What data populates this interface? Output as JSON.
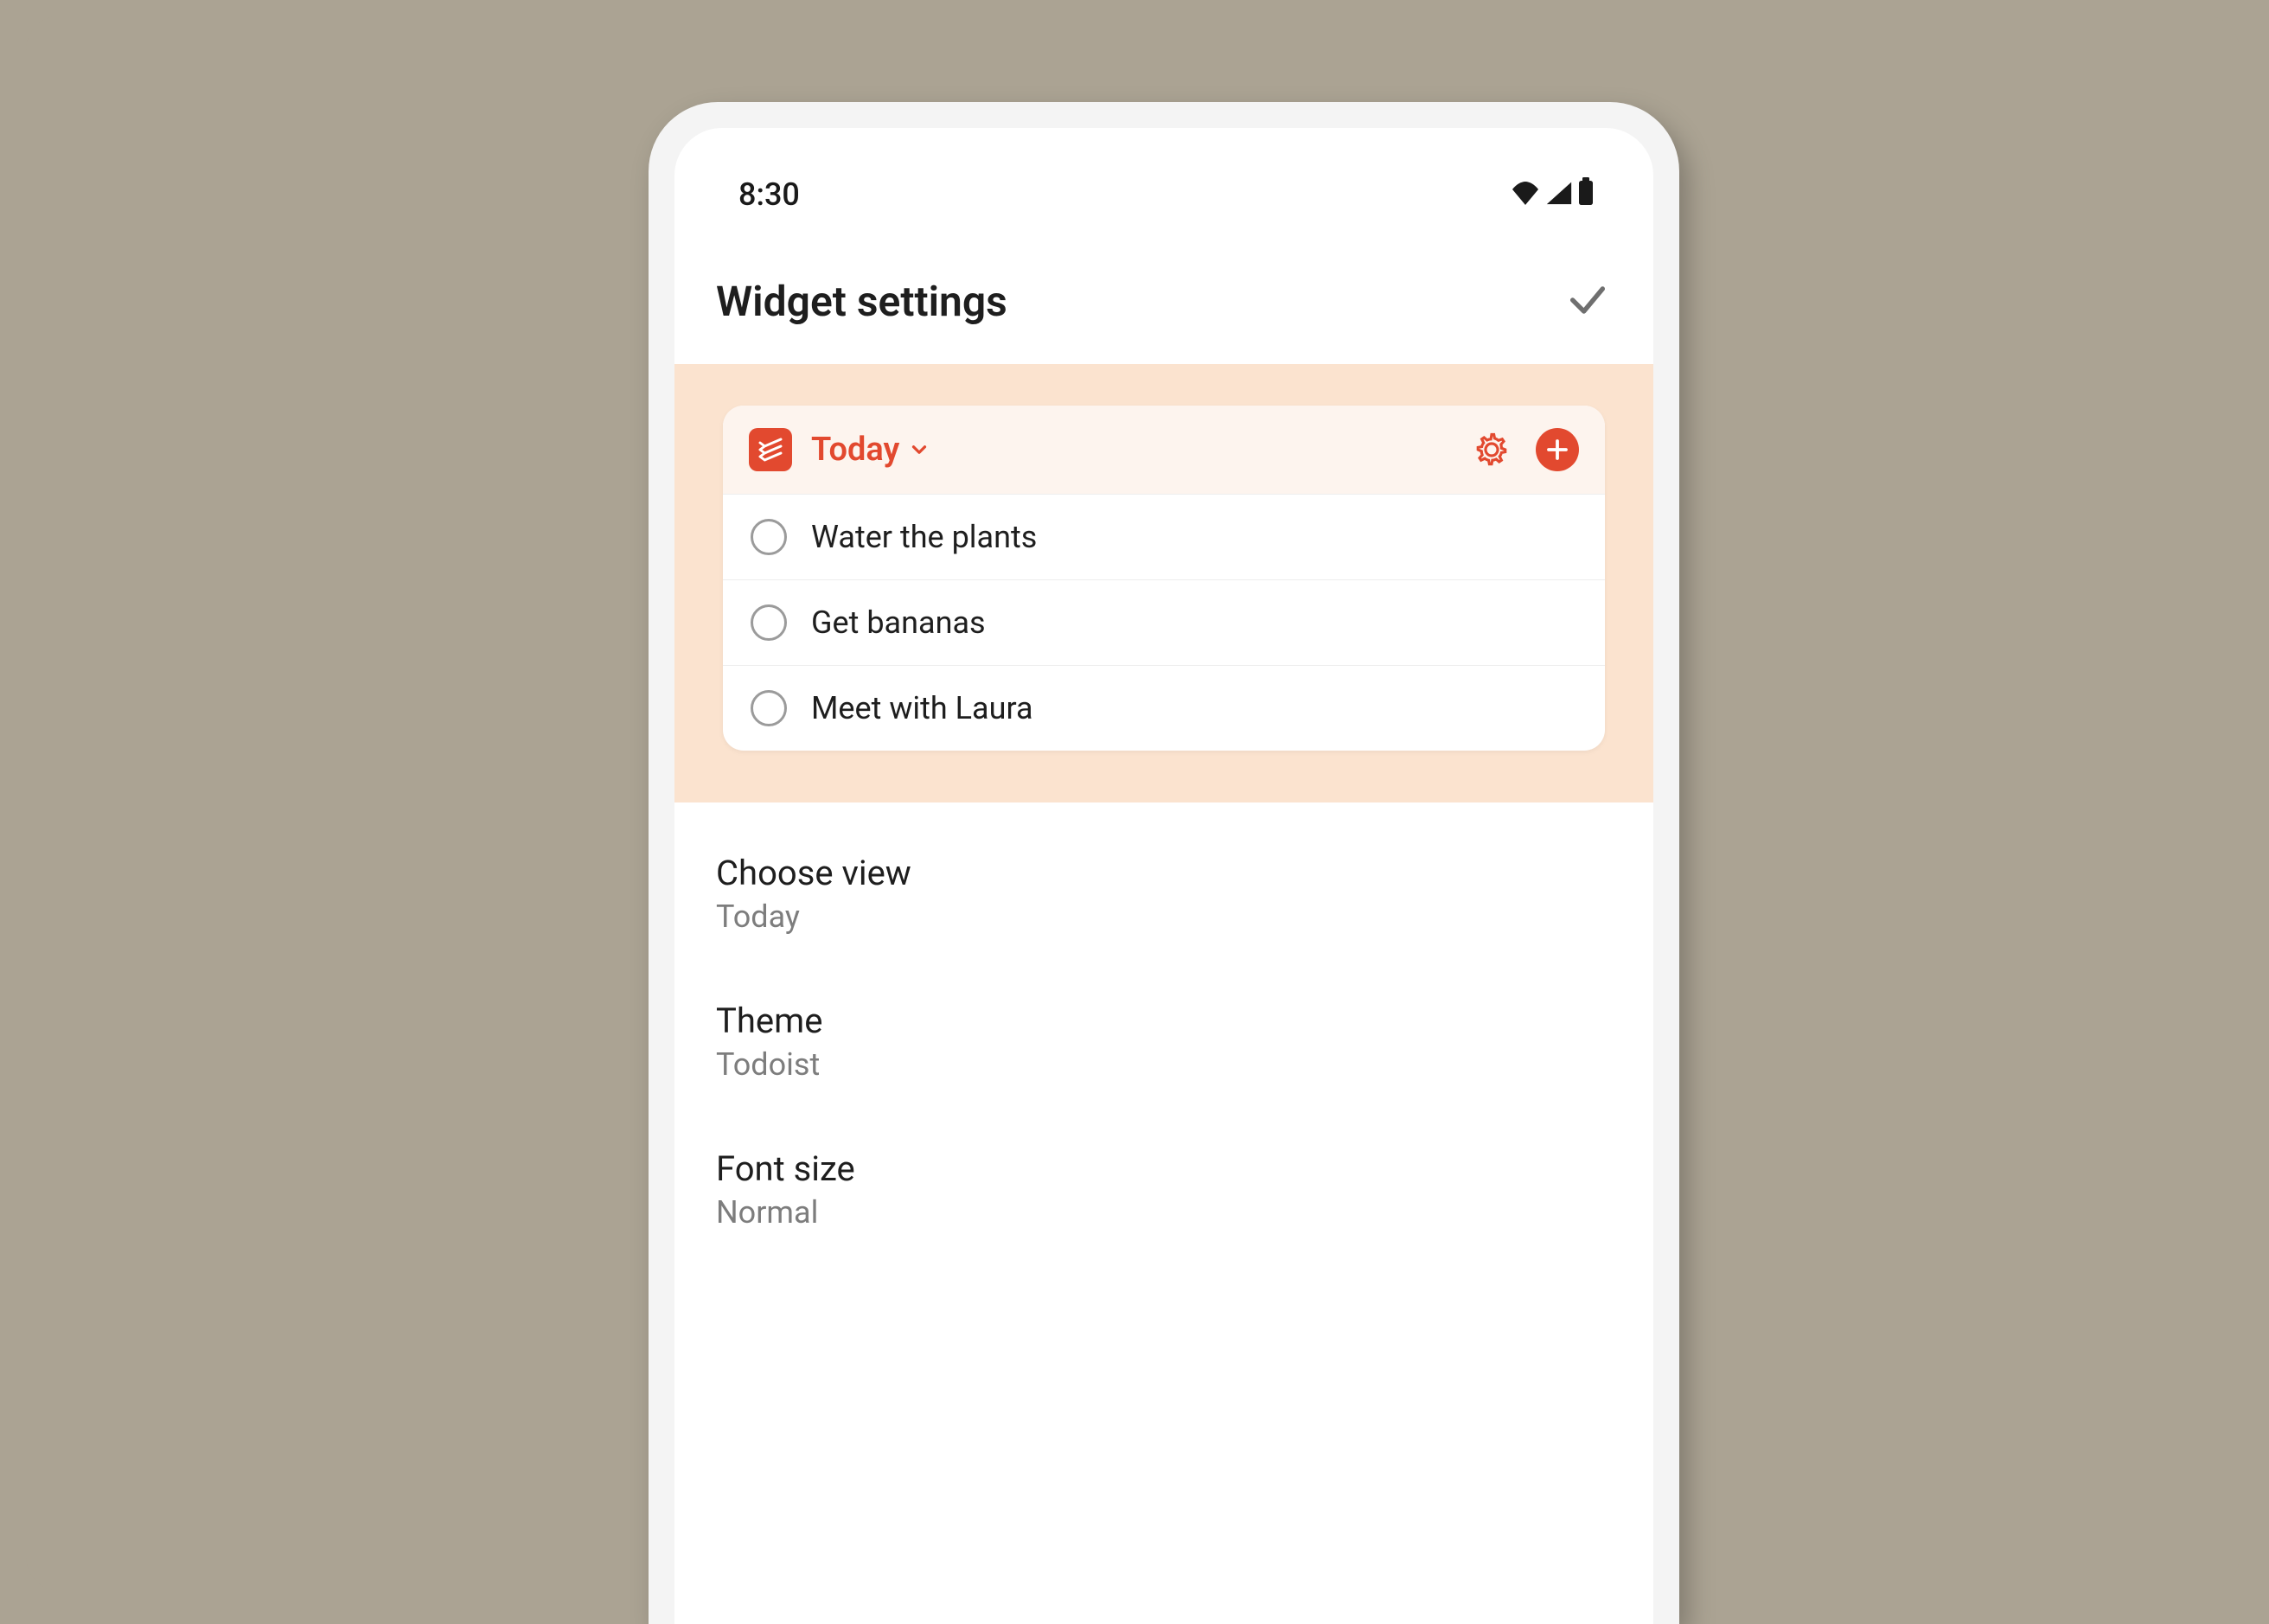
{
  "status_bar": {
    "time": "8:30"
  },
  "header": {
    "title": "Widget settings"
  },
  "widget_preview": {
    "view_label": "Today",
    "tasks": [
      {
        "title": "Water the plants"
      },
      {
        "title": "Get bananas"
      },
      {
        "title": "Meet with Laura"
      }
    ]
  },
  "settings": [
    {
      "label": "Choose view",
      "value": "Today"
    },
    {
      "label": "Theme",
      "value": "Todoist"
    },
    {
      "label": "Font size",
      "value": "Normal"
    }
  ]
}
